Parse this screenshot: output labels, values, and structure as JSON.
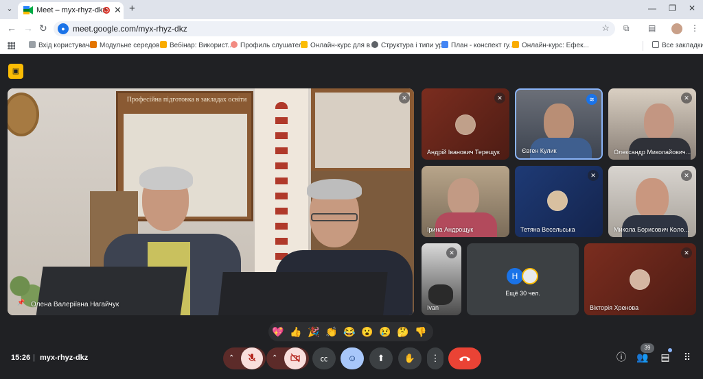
{
  "browser": {
    "tab_title": "Meet – myx-rhyz-dkz",
    "url": "meet.google.com/myx-rhyz-dkz",
    "bookmarks": [
      "Вхід користувача",
      "Модульне середов...",
      "Вебінар: Використ...",
      "Профиль слушател...",
      "Онлайн-курс для в...",
      "Структура і типи ур...",
      "План - конспект гу...",
      "Онлайн-курс: Ефек..."
    ],
    "all_bookmarks": "Все закладки"
  },
  "meeting": {
    "time": "15:26",
    "separator": "|",
    "code": "myx-rhyz-dkz",
    "participant_count": "39"
  },
  "main_tile": {
    "name": "Олена Валеріївна Нагайчук",
    "board_title": "Професійна підготовка в закладах освіти"
  },
  "participants": [
    {
      "name": "Андрій Іванович Терещук"
    },
    {
      "name": "Євген Кулик"
    },
    {
      "name": "Олександр Миколайович..."
    },
    {
      "name": "Ірина Андрощук"
    },
    {
      "name": "Тетяна Весельська"
    },
    {
      "name": "Микола Борисович Коло..."
    },
    {
      "name": "Ivan"
    },
    {
      "name": "Вікторія Хренова"
    }
  ],
  "others": {
    "avatar_letter": "H",
    "label": "Ещё 30 чел."
  },
  "reactions": [
    "💖",
    "👍",
    "🎉",
    "👏",
    "😂",
    "😮",
    "😢",
    "🤔",
    "👎"
  ],
  "colors": {
    "meet_bg": "#202124",
    "tile_bg": "#3c4043",
    "hangup": "#ea4335",
    "accent_blue": "#1a73e8",
    "info_chip": "#fbbc04"
  },
  "icons": {
    "mute": "mic-off-icon",
    "camera_off": "videocam-off-icon",
    "captions": "closed-captions-icon",
    "emoji": "emoji-icon",
    "present": "present-screen-icon",
    "hand": "raise-hand-icon",
    "more": "more-vert-icon",
    "hangup": "call-end-icon",
    "info": "info-icon",
    "people": "people-icon",
    "chat": "chat-icon",
    "activities": "apps-grid-icon"
  }
}
